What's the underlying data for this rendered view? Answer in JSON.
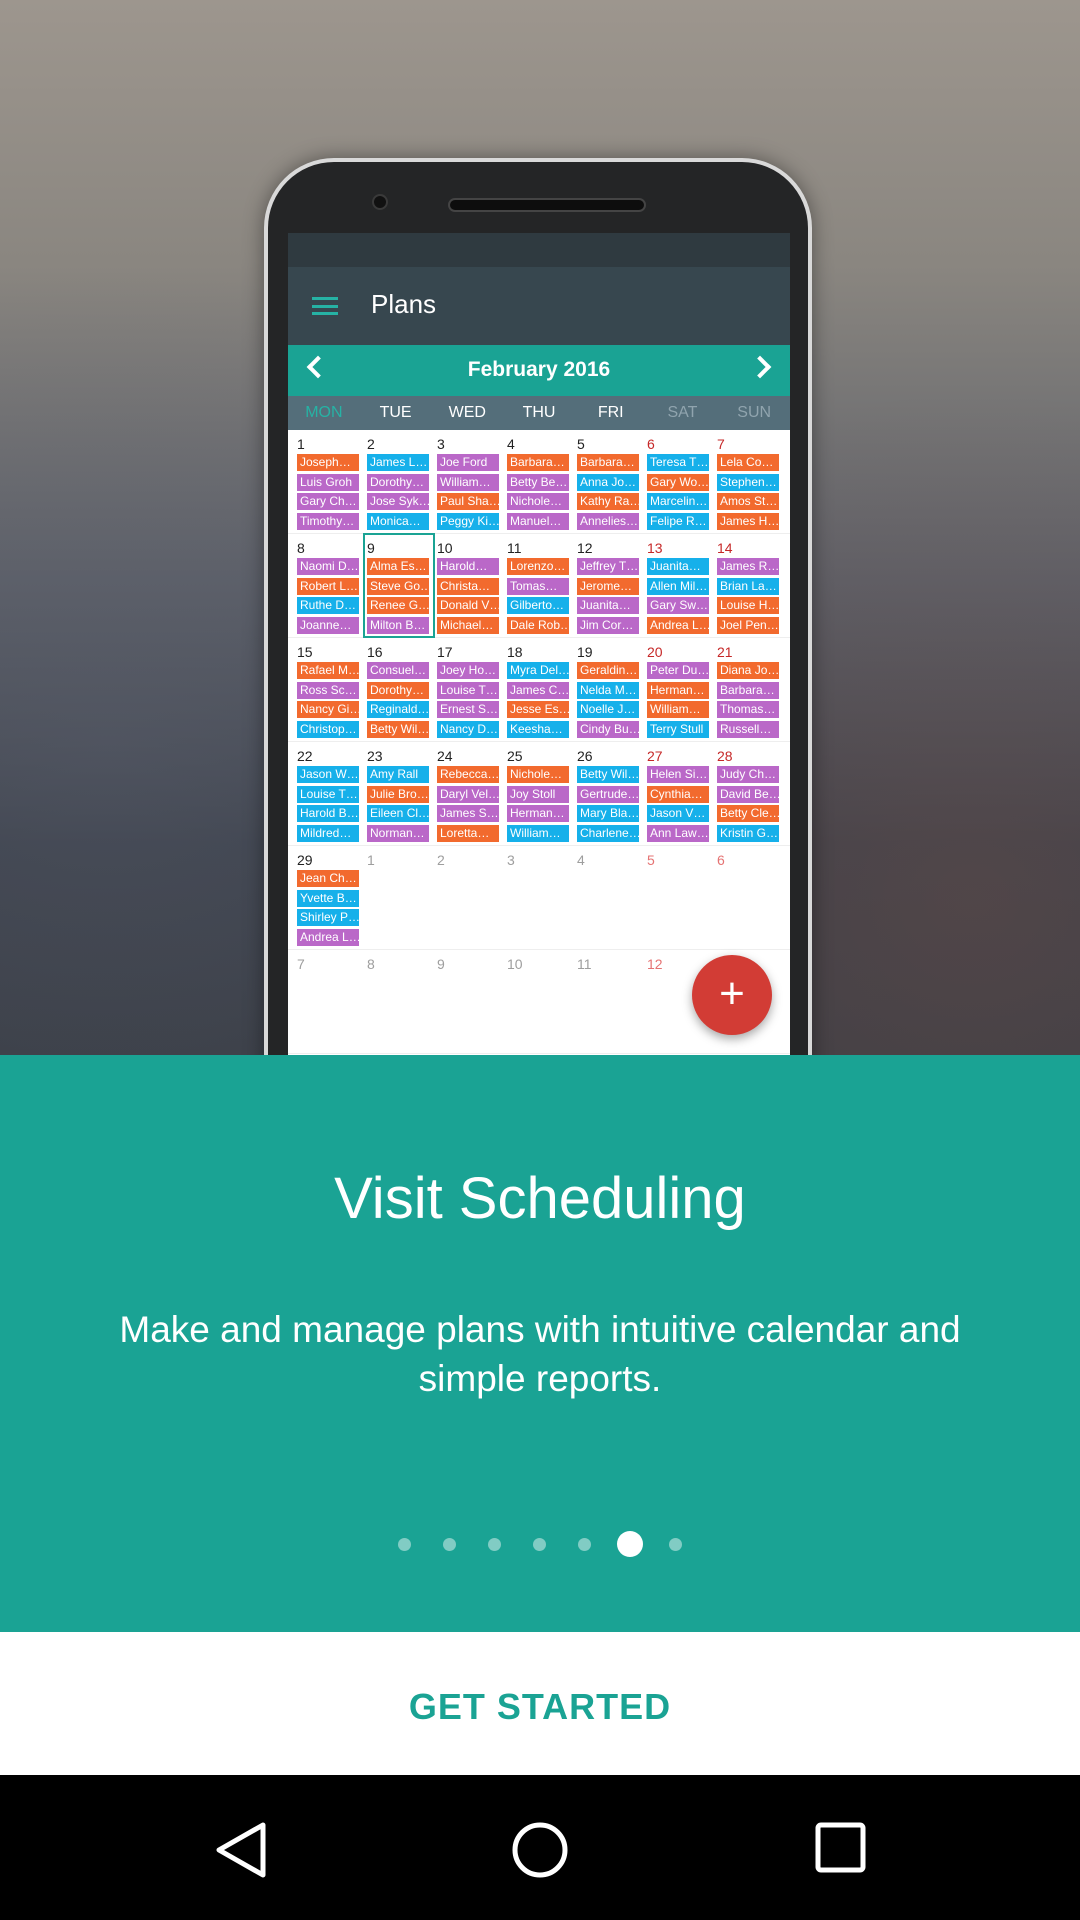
{
  "app": {
    "title": "Plans",
    "menu_icon": "hamburger-menu-icon"
  },
  "calendar": {
    "month_label": "February 2016",
    "weekdays": [
      "MON",
      "TUE",
      "WED",
      "THU",
      "FRI",
      "SAT",
      "SUN"
    ],
    "colors": {
      "o": "#f26a2e",
      "p": "#ba68c8",
      "b": "#16b0ea",
      "selected": "#1aa394",
      "weekend": "#c62828"
    },
    "selected_day": 9,
    "weeks": [
      [
        {
          "n": "1",
          "e": [
            [
              "Joseph…",
              "o"
            ],
            [
              "Luis Groh",
              "p"
            ],
            [
              "Gary Ch…",
              "p"
            ],
            [
              "Timothy…",
              "p"
            ]
          ]
        },
        {
          "n": "2",
          "e": [
            [
              "James L…",
              "b"
            ],
            [
              "Dorothy…",
              "p"
            ],
            [
              "Jose Syk…",
              "p"
            ],
            [
              "Monica…",
              "b"
            ]
          ]
        },
        {
          "n": "3",
          "e": [
            [
              "Joe Ford",
              "p"
            ],
            [
              "William…",
              "p"
            ],
            [
              "Paul Sha…",
              "o"
            ],
            [
              "Peggy Ki…",
              "b"
            ]
          ]
        },
        {
          "n": "4",
          "e": [
            [
              "Barbara…",
              "o"
            ],
            [
              "Betty Be…",
              "p"
            ],
            [
              "Nichole…",
              "p"
            ],
            [
              "Manuel…",
              "p"
            ]
          ]
        },
        {
          "n": "5",
          "e": [
            [
              "Barbara…",
              "o"
            ],
            [
              "Anna Jo…",
              "b"
            ],
            [
              "Kathy Ra…",
              "o"
            ],
            [
              "Annelies…",
              "p"
            ]
          ]
        },
        {
          "n": "6",
          "e": [
            [
              "Teresa T…",
              "b"
            ],
            [
              "Gary Wo…",
              "o"
            ],
            [
              "Marcelin…",
              "b"
            ],
            [
              "Felipe R…",
              "b"
            ]
          ]
        },
        {
          "n": "7",
          "e": [
            [
              "Lela Co…",
              "o"
            ],
            [
              "Stephen…",
              "b"
            ],
            [
              "Amos St…",
              "o"
            ],
            [
              "James H…",
              "o"
            ]
          ]
        }
      ],
      [
        {
          "n": "8",
          "e": [
            [
              "Naomi D…",
              "p"
            ],
            [
              "Robert L…",
              "o"
            ],
            [
              "Ruthe D…",
              "b"
            ],
            [
              "Joanne…",
              "p"
            ]
          ]
        },
        {
          "n": "9",
          "e": [
            [
              "Alma Es…",
              "o"
            ],
            [
              "Steve Go…",
              "o"
            ],
            [
              "Renee G…",
              "o"
            ],
            [
              "Milton B…",
              "p"
            ]
          ]
        },
        {
          "n": "10",
          "e": [
            [
              "Harold…",
              "p"
            ],
            [
              "Christa…",
              "o"
            ],
            [
              "Donald V…",
              "o"
            ],
            [
              "Michael…",
              "o"
            ]
          ]
        },
        {
          "n": "11",
          "e": [
            [
              "Lorenzo…",
              "o"
            ],
            [
              "Tomas…",
              "p"
            ],
            [
              "Gilberto…",
              "b"
            ],
            [
              "Dale Rob…",
              "o"
            ]
          ]
        },
        {
          "n": "12",
          "e": [
            [
              "Jeffrey T…",
              "p"
            ],
            [
              "Jerome…",
              "o"
            ],
            [
              "Juanita…",
              "p"
            ],
            [
              "Jim Cor…",
              "p"
            ]
          ]
        },
        {
          "n": "13",
          "e": [
            [
              "Juanita…",
              "b"
            ],
            [
              "Allen Mil…",
              "b"
            ],
            [
              "Gary Sw…",
              "p"
            ],
            [
              "Andrea L…",
              "o"
            ]
          ]
        },
        {
          "n": "14",
          "e": [
            [
              "James R…",
              "p"
            ],
            [
              "Brian La…",
              "b"
            ],
            [
              "Louise H…",
              "o"
            ],
            [
              "Joel Pen…",
              "o"
            ]
          ]
        }
      ],
      [
        {
          "n": "15",
          "e": [
            [
              "Rafael M…",
              "o"
            ],
            [
              "Ross Sc…",
              "p"
            ],
            [
              "Nancy Gi…",
              "o"
            ],
            [
              "Christop…",
              "b"
            ]
          ]
        },
        {
          "n": "16",
          "e": [
            [
              "Consuel…",
              "p"
            ],
            [
              "Dorothy…",
              "o"
            ],
            [
              "Reginald…",
              "b"
            ],
            [
              "Betty Wil…",
              "o"
            ]
          ]
        },
        {
          "n": "17",
          "e": [
            [
              "Joey Ho…",
              "p"
            ],
            [
              "Louise T…",
              "p"
            ],
            [
              "Ernest S…",
              "p"
            ],
            [
              "Nancy D…",
              "b"
            ]
          ]
        },
        {
          "n": "18",
          "e": [
            [
              "Myra Del…",
              "b"
            ],
            [
              "James C…",
              "p"
            ],
            [
              "Jesse Es…",
              "o"
            ],
            [
              "Keesha…",
              "b"
            ]
          ]
        },
        {
          "n": "19",
          "e": [
            [
              "Geraldin…",
              "o"
            ],
            [
              "Nelda M…",
              "b"
            ],
            [
              "Noelle J…",
              "b"
            ],
            [
              "Cindy Bu…",
              "p"
            ]
          ]
        },
        {
          "n": "20",
          "e": [
            [
              "Peter Du…",
              "p"
            ],
            [
              "Herman…",
              "o"
            ],
            [
              "William…",
              "o"
            ],
            [
              "Terry Stull",
              "b"
            ]
          ]
        },
        {
          "n": "21",
          "e": [
            [
              "Diana Jo…",
              "o"
            ],
            [
              "Barbara…",
              "p"
            ],
            [
              "Thomas…",
              "p"
            ],
            [
              "Russell…",
              "p"
            ]
          ]
        }
      ],
      [
        {
          "n": "22",
          "e": [
            [
              "Jason W…",
              "b"
            ],
            [
              "Louise T…",
              "b"
            ],
            [
              "Harold B…",
              "b"
            ],
            [
              "Mildred…",
              "b"
            ]
          ]
        },
        {
          "n": "23",
          "e": [
            [
              "Amy Rall",
              "b"
            ],
            [
              "Julie Bro…",
              "o"
            ],
            [
              "Eileen Cl…",
              "b"
            ],
            [
              "Norman…",
              "p"
            ]
          ]
        },
        {
          "n": "24",
          "e": [
            [
              "Rebecca…",
              "o"
            ],
            [
              "Daryl Vel…",
              "p"
            ],
            [
              "James S…",
              "p"
            ],
            [
              "Loretta…",
              "o"
            ]
          ]
        },
        {
          "n": "25",
          "e": [
            [
              "Nichole…",
              "o"
            ],
            [
              "Joy Stoll",
              "p"
            ],
            [
              "Herman…",
              "p"
            ],
            [
              "William…",
              "b"
            ]
          ]
        },
        {
          "n": "26",
          "e": [
            [
              "Betty Wil…",
              "b"
            ],
            [
              "Gertrude…",
              "p"
            ],
            [
              "Mary Bla…",
              "b"
            ],
            [
              "Charlene…",
              "b"
            ]
          ]
        },
        {
          "n": "27",
          "e": [
            [
              "Helen Si…",
              "p"
            ],
            [
              "Cynthia…",
              "o"
            ],
            [
              "Jason V…",
              "b"
            ],
            [
              "Ann Law…",
              "p"
            ]
          ]
        },
        {
          "n": "28",
          "e": [
            [
              "Judy Ch…",
              "p"
            ],
            [
              "David Be…",
              "p"
            ],
            [
              "Betty Cle…",
              "o"
            ],
            [
              "Kristin G…",
              "b"
            ]
          ]
        }
      ],
      [
        {
          "n": "29",
          "e": [
            [
              "Jean Ch…",
              "o"
            ],
            [
              "Yvette B…",
              "b"
            ],
            [
              "Shirley P…",
              "b"
            ],
            [
              "Andrea L…",
              "p"
            ]
          ]
        },
        {
          "n": "1",
          "om": true,
          "e": []
        },
        {
          "n": "2",
          "om": true,
          "e": []
        },
        {
          "n": "3",
          "om": true,
          "e": []
        },
        {
          "n": "4",
          "om": true,
          "e": []
        },
        {
          "n": "5",
          "om": true,
          "e": []
        },
        {
          "n": "6",
          "om": true,
          "e": []
        }
      ],
      [
        {
          "n": "7",
          "om": true,
          "e": []
        },
        {
          "n": "8",
          "om": true,
          "e": []
        },
        {
          "n": "9",
          "om": true,
          "e": []
        },
        {
          "n": "10",
          "om": true,
          "e": []
        },
        {
          "n": "11",
          "om": true,
          "e": []
        },
        {
          "n": "12",
          "om": true,
          "e": []
        },
        {
          "n": "",
          "om": true,
          "e": []
        }
      ]
    ],
    "fab_label": "+"
  },
  "onboarding": {
    "title": "Visit Scheduling",
    "subtitle": "Make and manage plans with intuitive calendar and simple reports.",
    "page_count": 7,
    "current_page": 6,
    "cta": "GET STARTED",
    "accent": "#1aa394"
  },
  "navbar": {
    "icons": [
      "back-icon",
      "home-icon",
      "recents-icon"
    ]
  }
}
